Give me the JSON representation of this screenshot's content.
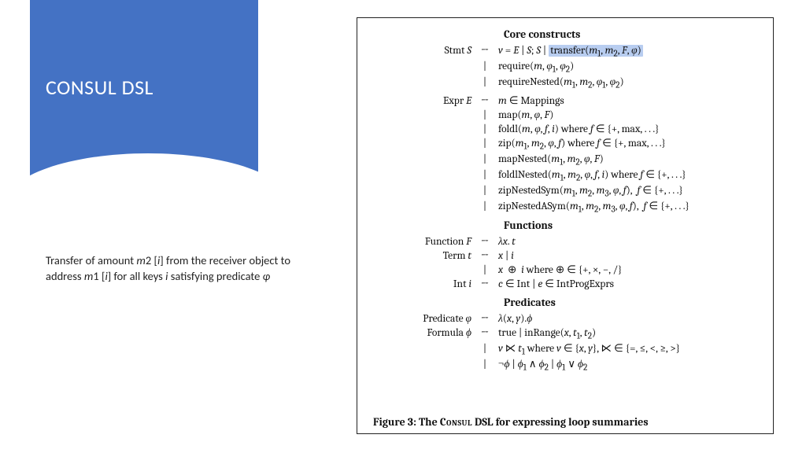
{
  "title": "CONSUL DSL",
  "description_html": "Transfer of amount <span class='mi'>m</span>2 [<span class='mi'>i</span>] from the receiver object to address <span class='mi'>m</span>1 [<span class='mi'>i</span>] for all keys <span class='mi'>i</span> satisfying predicate <span class='mi'>φ</span>",
  "sections": {
    "core": "Core constructs",
    "functions": "Functions",
    "predicates": "Predicates"
  },
  "rules": {
    "stmt_lhs": "Stmt <span class='it'>S</span>",
    "stmt0": "<span class='it'>v</span> = <span class='it'>E</span> | <span class='it'>S</span>; <span class='it'>S</span> | <span class='hl'>transfer(<span class='it'>m</span><sub>1</sub>, <span class='it'>m</span><sub>2</sub>, <span class='it'>F</span>, <span class='it'>φ</span>)</span>",
    "stmt1": "require(<span class='it'>m</span>, <span class='it'>φ</span><sub>1</sub>, <span class='it'>φ</span><sub>2</sub>)",
    "stmt2": "requireNested(<span class='it'>m</span><sub>1</sub>, <span class='it'>m</span><sub>2</sub>, <span class='it'>φ</span><sub>1</sub>, <span class='it'>φ</span><sub>2</sub>)",
    "expr_lhs": "Expr <span class='it'>E</span>",
    "expr0": "<span class='it'>m</span> ∈ Mappings",
    "expr1": "map(<span class='it'>m</span>, <span class='it'>φ</span>, <span class='it'>F</span>)",
    "expr2": "foldl(<span class='it'>m</span>, <span class='it'>φ</span>, <span class='it'>f</span>, <span class='it'>i</span>) where <span class='it'>f</span> ∈ {+, max, . . .}",
    "expr3": "zip(<span class='it'>m</span><sub>1</sub>, <span class='it'>m</span><sub>2</sub>, <span class='it'>φ</span>, <span class='it'>f</span>) where <span class='it'>f</span> ∈ {+, max, . . .}",
    "expr4": "mapNested(<span class='it'>m</span><sub>1</sub>, <span class='it'>m</span><sub>2</sub>, <span class='it'>φ</span>, <span class='it'>F</span>)",
    "expr5": "foldlNested(<span class='it'>m</span><sub>1</sub>, <span class='it'>m</span><sub>2</sub>, <span class='it'>φ</span>, <span class='it'>f</span>, <span class='it'>i</span>) where <span class='it'>f</span> ∈ {+, . . .}",
    "expr6": "zipNestedSym(<span class='it'>m</span><sub>1</sub>, <span class='it'>m</span><sub>2</sub>, <span class='it'>m</span><sub>3</sub>, <span class='it'>φ</span>, <span class='it'>f</span>),&nbsp;&nbsp;<span class='it'>f</span> ∈ {+, . . .}",
    "expr7": "zipNestedASym(<span class='it'>m</span><sub>1</sub>, <span class='it'>m</span><sub>2</sub>, <span class='it'>m</span><sub>3</sub>, <span class='it'>φ</span>, <span class='it'>f</span>),&nbsp;&nbsp;<span class='it'>f</span> ∈ {+, . . .}",
    "func_lhs": "Function <span class='it'>F</span>",
    "func0": "<span class='it'>λx</span>. <span class='it'>t</span>",
    "term_lhs": "Term <span class='it'>t</span>",
    "term0": "<span class='it'>x</span> | <span class='it'>i</span>",
    "term1": "<span class='it'>x</span> &nbsp;⊕&nbsp; <span class='it'>i</span> where ⊕ ∈ {+, ×, −, /}",
    "int_lhs": "Int <span class='it'>i</span>",
    "int0": "<span class='it'>c</span> ∈ Int | <span class='it'>e</span> ∈ IntProgExprs",
    "pred_lhs": "Predicate <span class='it'>φ</span>",
    "pred0": "<span class='it'>λ</span>(<span class='it'>x</span>, <span class='it'>y</span>).<span class='it'>ϕ</span>",
    "form_lhs": "Formula <span class='it'>ϕ</span>",
    "form0": "true | inRange(<span class='it'>x</span>, <span class='it'>t</span><sub>1</sub>, <span class='it'>t</span><sub>2</sub>)",
    "form1": "<span class='it'>v</span> ⋉ <span class='it'>t</span><sub>1</sub> where <span class='it'>v</span> ∈ {<span class='it'>x</span>, <span class='it'>y</span>}, ⋉ ∈ {=, ≤, &lt;, ≥, &gt;}",
    "form2": "¬<span class='it'>ϕ</span> | <span class='it'>ϕ</span><sub>1</sub> ∧ <span class='it'>ϕ</span><sub>2</sub> | <span class='it'>ϕ</span><sub>1</sub> ∨ <span class='it'>ϕ</span><sub>2</sub>"
  },
  "caption_html": "<b>Figure 3: The <span class='sc'>Consul</span> DSL for expressing loop summaries</b>"
}
